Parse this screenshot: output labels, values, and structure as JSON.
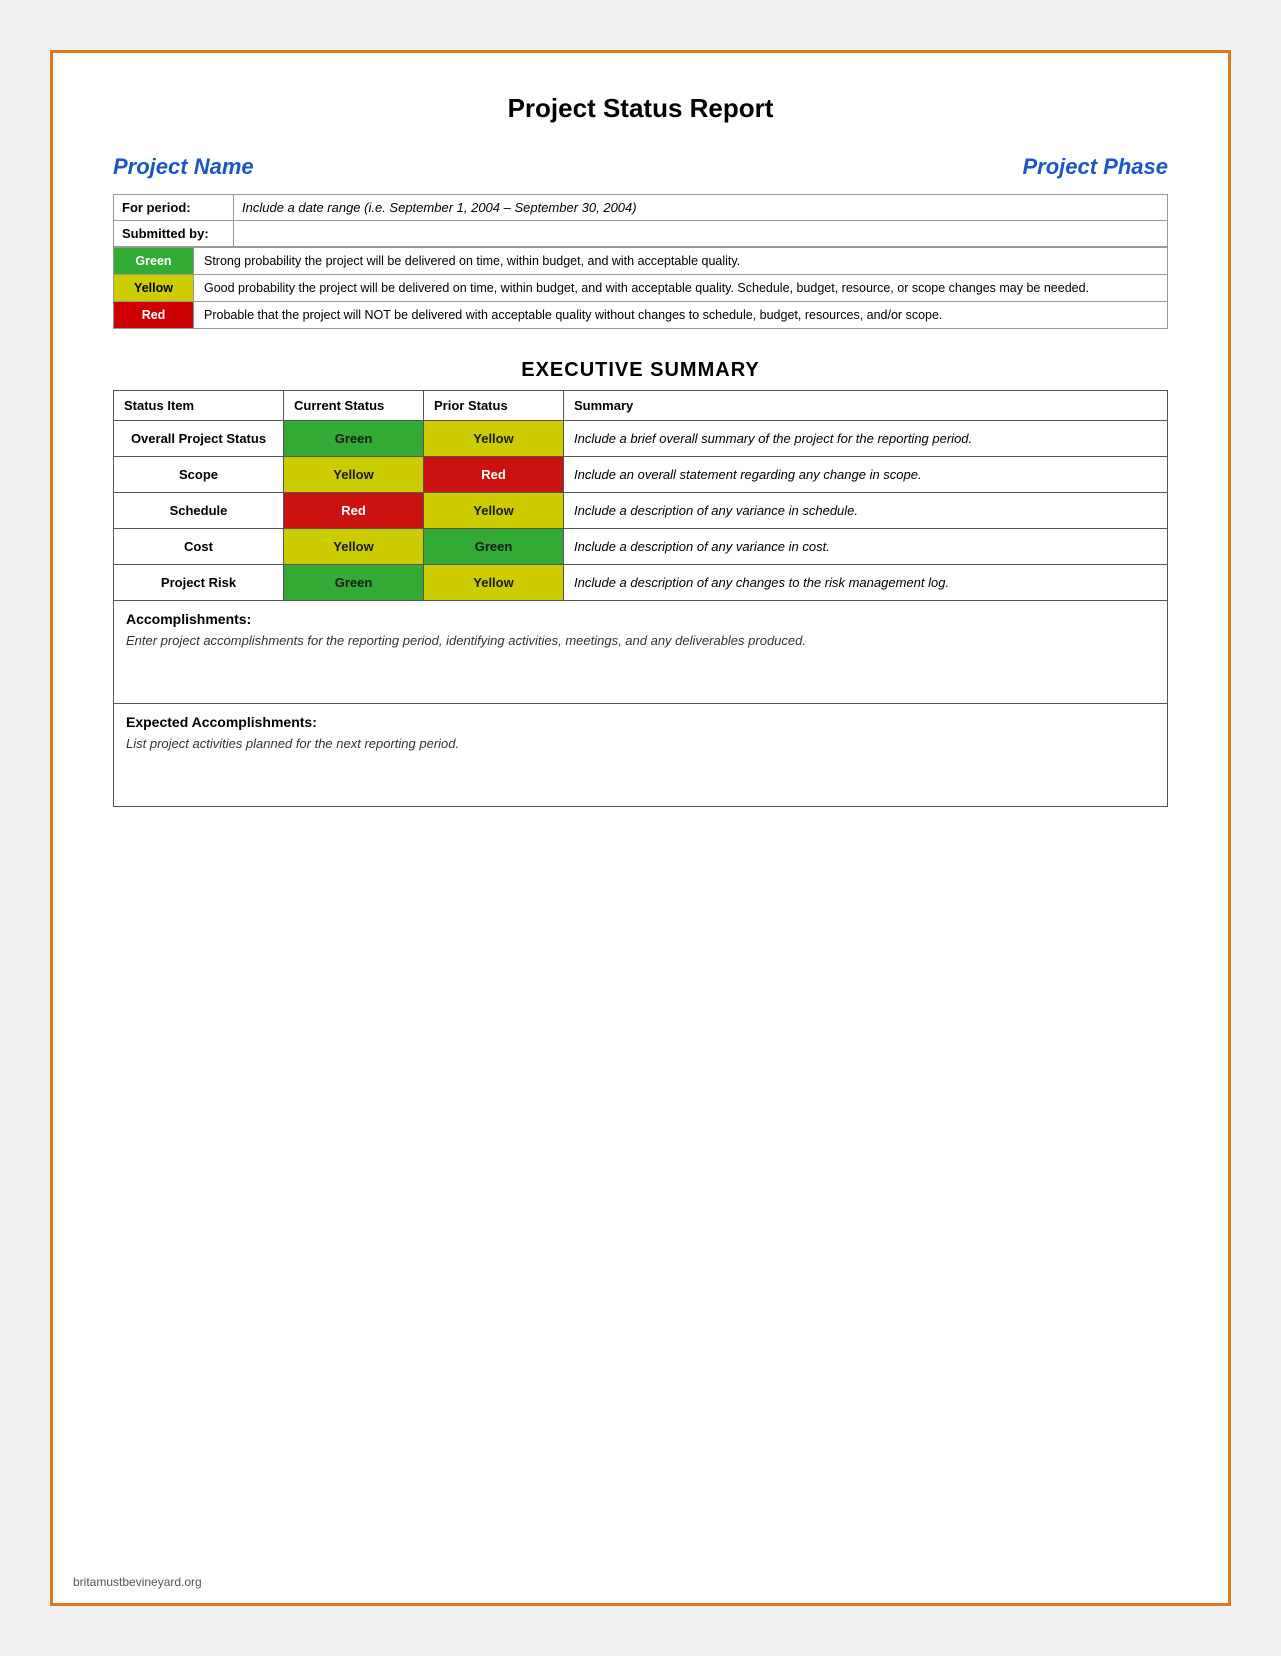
{
  "page": {
    "title": "Project Status Report",
    "project_name_label": "Project Name",
    "project_phase_label": "Project Phase",
    "for_period_label": "For period:",
    "for_period_value": "Include a date range (i.e. September 1, 2004 – September 30, 2004)",
    "submitted_by_label": "Submitted by:",
    "submitted_by_value": ""
  },
  "legend": [
    {
      "color_label": "Green",
      "color_class": "legend-green",
      "description": "Strong probability the project will be delivered on time, within budget, and with acceptable quality."
    },
    {
      "color_label": "Yellow",
      "color_class": "legend-yellow",
      "description": "Good probability the project will be delivered on time, within budget, and with acceptable quality. Schedule, budget, resource, or scope changes may be needed."
    },
    {
      "color_label": "Red",
      "color_class": "legend-red",
      "description": "Probable that the project will NOT be delivered with acceptable quality without changes to schedule, budget, resources, and/or scope."
    }
  ],
  "executive_summary": {
    "title": "EXECUTIVE SUMMARY",
    "columns": [
      "Status Item",
      "Current Status",
      "Prior Status",
      "Summary"
    ],
    "rows": [
      {
        "item": "Overall Project Status",
        "current": "Green",
        "current_class": "status-green",
        "prior": "Yellow",
        "prior_class": "status-yellow",
        "summary": "Include a brief overall summary of the project for the reporting period."
      },
      {
        "item": "Scope",
        "current": "Yellow",
        "current_class": "status-yellow",
        "prior": "Red",
        "prior_class": "status-red",
        "summary": "Include an overall statement regarding any change in scope."
      },
      {
        "item": "Schedule",
        "current": "Red",
        "current_class": "status-red",
        "prior": "Yellow",
        "prior_class": "status-yellow",
        "summary": "Include a description of any variance in schedule."
      },
      {
        "item": "Cost",
        "current": "Yellow",
        "current_class": "status-yellow",
        "prior": "Green",
        "prior_class": "status-green",
        "summary": "Include a description of any variance in cost."
      },
      {
        "item": "Project Risk",
        "current": "Green",
        "current_class": "status-green",
        "prior": "Yellow",
        "prior_class": "status-yellow",
        "summary": "Include a description of any changes to the risk management log."
      }
    ]
  },
  "accomplishments": {
    "title": "Accomplishments:",
    "text": "Enter project accomplishments for the reporting period, identifying activities, meetings, and any deliverables produced."
  },
  "expected_accomplishments": {
    "title": "Expected Accomplishments:",
    "text": "List project activities planned for the next reporting period."
  },
  "footer": {
    "text": "britamustbevineyard.org"
  }
}
